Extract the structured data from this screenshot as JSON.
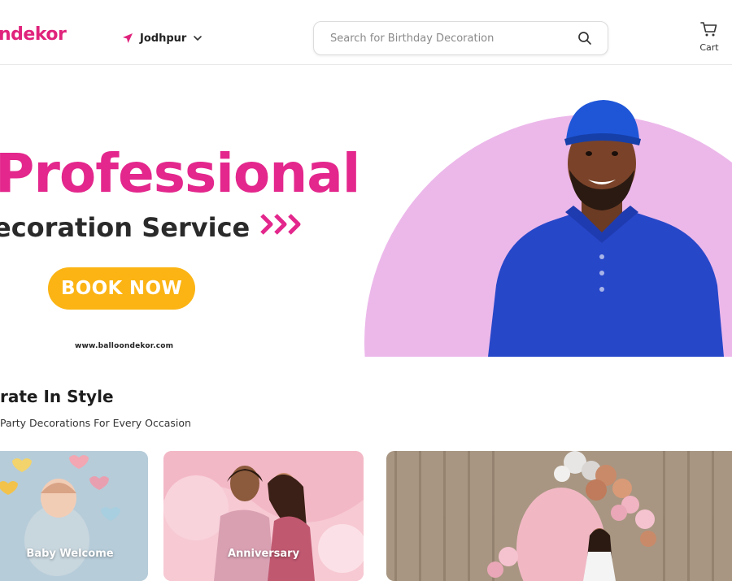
{
  "header": {
    "logo_text": "ndekor",
    "location": "Jodhpur",
    "search_placeholder": "Search for Birthday Decoration",
    "cart_label": "Cart"
  },
  "banner": {
    "headline": "Professional",
    "subline": "ecoration Service",
    "cta_label": "BOOK NOW",
    "website": "www.balloondekor.com"
  },
  "section": {
    "title": "rate In Style",
    "subtitle": "Party Decorations For Every Occasion",
    "cards": [
      {
        "label": "Baby Welcome"
      },
      {
        "label": "Anniversary"
      },
      {
        "label": ""
      }
    ]
  },
  "colors": {
    "brand_pink": "#e3278c",
    "cta_yellow": "#fbb414",
    "banner_arc": "#ecb8ea"
  },
  "icons": [
    "location-arrow-icon",
    "chevron-down-icon",
    "search-icon",
    "cart-icon",
    "triple-chevron-icon"
  ]
}
